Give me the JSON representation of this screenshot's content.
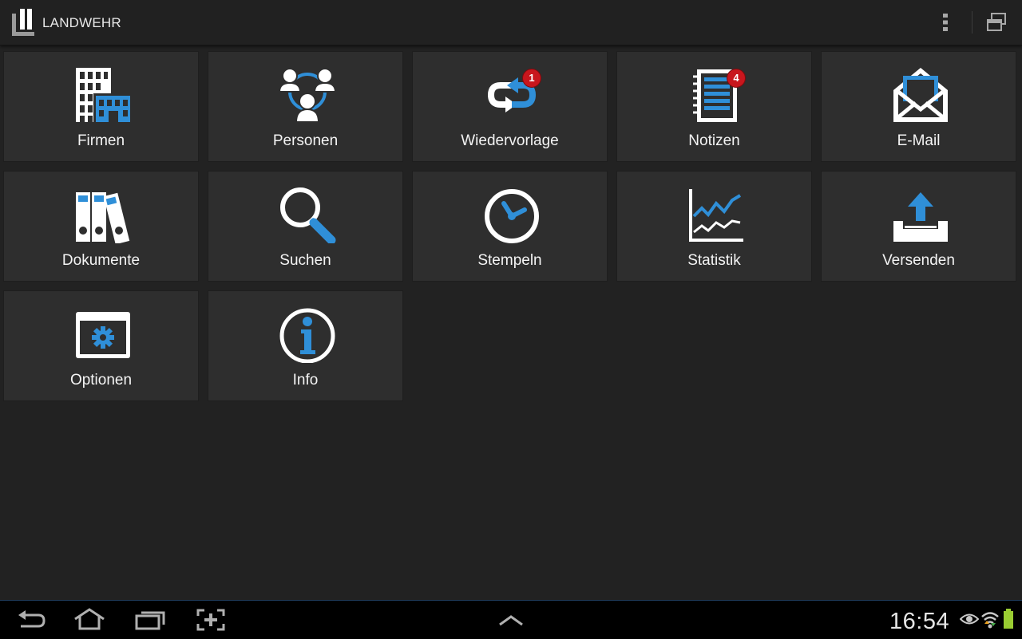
{
  "app": {
    "title": "LANDWEHR"
  },
  "colors": {
    "accent": "#2f8fd8",
    "badge": "#c8161d",
    "tile": "#2e2e2e",
    "background": "#222222"
  },
  "tiles": [
    {
      "label": "Firmen",
      "icon": "buildings-icon"
    },
    {
      "label": "Personen",
      "icon": "people-network-icon"
    },
    {
      "label": "Wiedervorlage",
      "icon": "refresh-arrows-icon",
      "badge": "1"
    },
    {
      "label": "Notizen",
      "icon": "notepad-icon",
      "badge": "4"
    },
    {
      "label": "E-Mail",
      "icon": "envelope-icon"
    },
    {
      "label": "Dokumente",
      "icon": "binders-icon"
    },
    {
      "label": "Suchen",
      "icon": "magnifier-icon"
    },
    {
      "label": "Stempeln",
      "icon": "clock-icon"
    },
    {
      "label": "Statistik",
      "icon": "line-chart-icon"
    },
    {
      "label": "Versenden",
      "icon": "upload-tray-icon"
    },
    {
      "label": "Optionen",
      "icon": "settings-window-icon"
    },
    {
      "label": "Info",
      "icon": "info-icon"
    }
  ],
  "statusbar": {
    "time": "16:54"
  }
}
